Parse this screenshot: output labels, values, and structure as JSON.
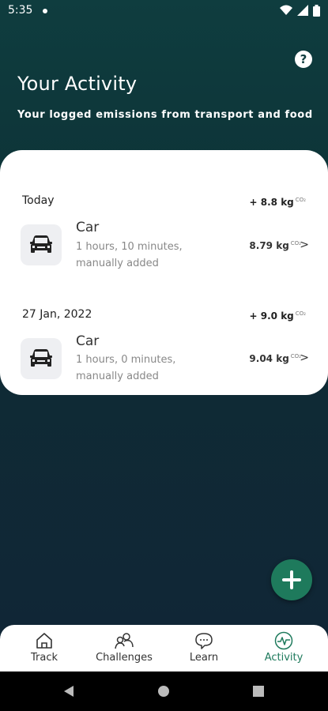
{
  "status_bar": {
    "time": "5:35"
  },
  "header": {
    "title": "Your Activity",
    "subtitle": "Your logged emissions from transport and food"
  },
  "groups": [
    {
      "date": "Today",
      "total": "+ 8.8 kg",
      "total_unit": "CO₂",
      "entries": [
        {
          "icon": "car-icon",
          "title": "Car",
          "detail_line1": "1 hours, 10 minutes,",
          "detail_line2": "manually added",
          "value": "8.79 kg",
          "unit": "CO₂"
        }
      ]
    },
    {
      "date": "27 Jan, 2022",
      "total": "+ 9.0 kg",
      "total_unit": "CO₂",
      "entries": [
        {
          "icon": "car-icon",
          "title": "Car",
          "detail_line1": "1 hours, 0 minutes,",
          "detail_line2": "manually added",
          "value": "9.04 kg",
          "unit": "CO₂"
        }
      ]
    }
  ],
  "nav": {
    "items": [
      {
        "label": "Track",
        "icon": "home-icon",
        "active": false
      },
      {
        "label": "Challenges",
        "icon": "people-icon",
        "active": false
      },
      {
        "label": "Learn",
        "icon": "chat-bubble-icon",
        "active": false
      },
      {
        "label": "Activity",
        "icon": "activity-pulse-icon",
        "active": true
      }
    ]
  },
  "colors": {
    "accent": "#1e7a5c",
    "background_top": "#0f3d3f",
    "background_bottom": "#112536"
  }
}
